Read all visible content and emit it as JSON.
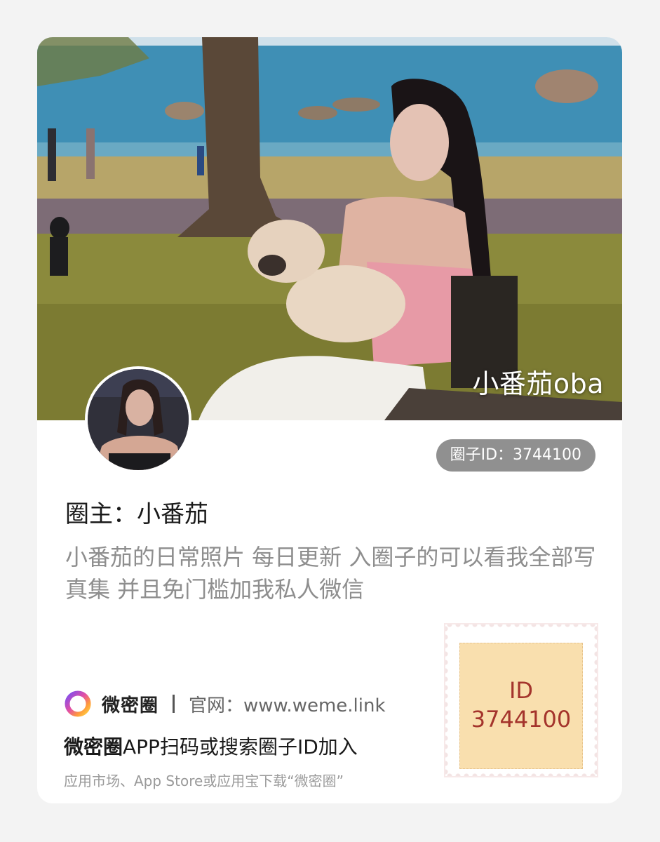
{
  "cover": {
    "caption": "小番茄oba"
  },
  "circle": {
    "id_badge": "圈子ID：3744100",
    "owner": "圈主：小番茄",
    "description": "小番茄的日常照片 每日更新 入圈子的可以看我全部写真集 并且免门槛加我私人微信"
  },
  "footer": {
    "brand_name": "微密圈",
    "site": "官网：www.weme.link",
    "instruction_brand": "微密圈",
    "instruction_text": "APP扫码或搜索圈子ID加入",
    "download_text": "应用市场、App Store或应用宝下载“微密圈”"
  },
  "stamp": {
    "label": "ID",
    "number": "3744100"
  },
  "colors": {
    "badge_bg": "#909090",
    "stamp_bg": "#f9dfae",
    "stamp_text": "#a4342c",
    "desc_text": "#8e8e8e"
  }
}
